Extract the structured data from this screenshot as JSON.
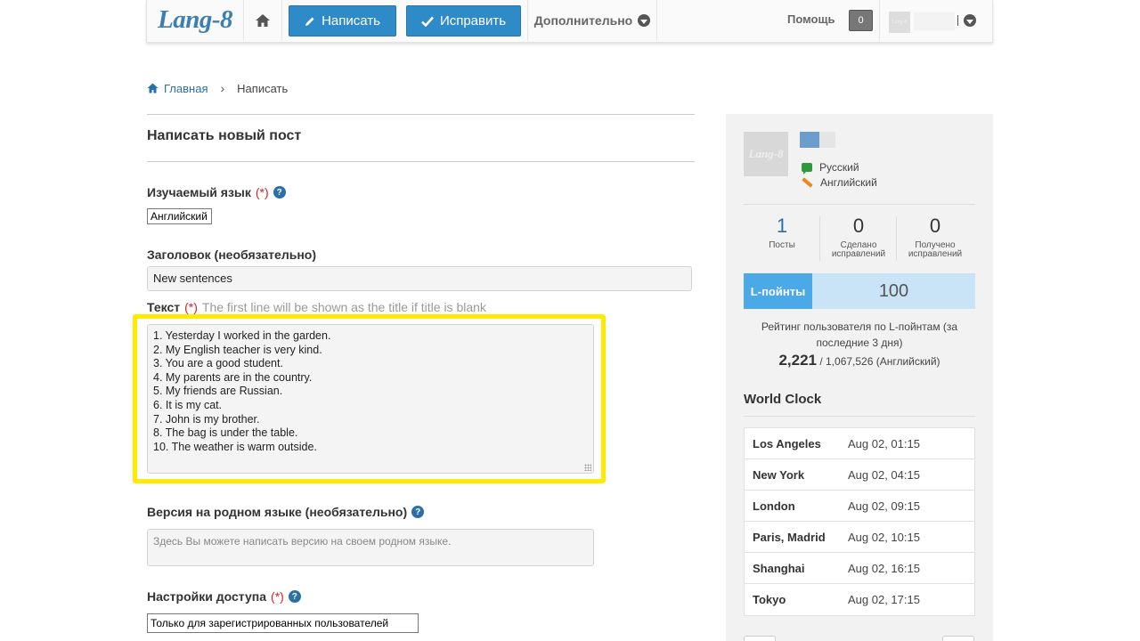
{
  "header": {
    "logo": "Lang-8",
    "write_label": "Написать",
    "correct_label": "Исправить",
    "more_label": "Дополнительно",
    "help_label": "Помощь",
    "notification_count": "0",
    "avatar_logo": "Lang-8"
  },
  "breadcrumb": {
    "home": "Главная",
    "current": "Написать"
  },
  "form": {
    "page_title": "Написать новый пост",
    "learning_language_label": "Изучаемый язык",
    "required_mark": "(*)",
    "learning_language_value": "Английский",
    "title_label": "Заголовок (необязательно)",
    "title_value": "New sentences",
    "text_label": "Текст",
    "text_hint": "The first line will be shown as the title if title is blank",
    "text_lines": [
      "1. Yesterday I worked in the garden.",
      "2. My English teacher is very kind.",
      "3. You are a good student.",
      "4. My parents are in the country.",
      "5. My friends are Russian.",
      "6. It is my cat.",
      "7. John is my brother.",
      "8. The bag is under the table.",
      "10. The weather is warm outside."
    ],
    "native_label": "Версия на родном языке (необязательно)",
    "native_placeholder": "Здесь Вы можете написать версию на своем родном языке.",
    "access_label": "Настройки доступа",
    "access_value": "Только для зарегистрированных пользователей"
  },
  "sidebar": {
    "avatar_logo": "Lang-8",
    "native_language": "Русский",
    "learning_language": "Английский",
    "stats": [
      {
        "value": "1",
        "label": "Посты"
      },
      {
        "value": "0",
        "label": "Сделано исправлений"
      },
      {
        "value": "0",
        "label": "Получено исправлений"
      }
    ],
    "lpoints_label": "L-пойнты",
    "lpoints_value": "100",
    "rating_text": "Рейтинг пользователя по L-пойнтам (за последние 3 дня)",
    "rank_value": "2,221",
    "rank_total": "/ 1,067,526 (Английский)",
    "world_clock_title": "World Clock",
    "clocks": [
      {
        "city": "Los Angeles",
        "time": "Aug 02, 01:15"
      },
      {
        "city": "New York",
        "time": "Aug 02, 04:15"
      },
      {
        "city": "London",
        "time": "Aug 02, 09:15"
      },
      {
        "city": "Paris, Madrid",
        "time": "Aug 02, 10:15"
      },
      {
        "city": "Shanghai",
        "time": "Aug 02, 16:15"
      },
      {
        "city": "Tokyo",
        "time": "Aug 02, 17:15"
      }
    ]
  }
}
